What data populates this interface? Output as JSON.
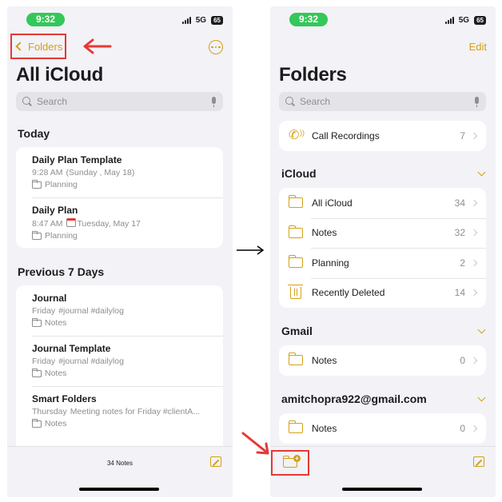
{
  "status": {
    "time": "9:32",
    "network": "5G",
    "battery": "65"
  },
  "left": {
    "back_label": "Folders",
    "title": "All iCloud",
    "search_placeholder": "Search",
    "sections": [
      {
        "title": "Today",
        "notes": [
          {
            "title": "Daily Plan Template",
            "time": "9:28 AM",
            "preview": "(Sunday , May 18)",
            "folder": "Planning",
            "calendar": false
          },
          {
            "title": "Daily Plan",
            "time": "8:47 AM",
            "preview": "Tuesday, May 17",
            "folder": "Planning",
            "calendar": true
          }
        ]
      },
      {
        "title": "Previous 7 Days",
        "notes": [
          {
            "title": "Journal",
            "time": "Friday",
            "preview": "#journal #dailylog",
            "folder": "Notes",
            "calendar": false
          },
          {
            "title": "Journal Template",
            "time": "Friday",
            "preview": "#journal #dailylog",
            "folder": "Notes",
            "calendar": false
          },
          {
            "title": "Smart Folders",
            "time": "Thursday",
            "preview": "Meeting notes for Friday #clientA...",
            "folder": "Notes",
            "calendar": false
          }
        ]
      }
    ],
    "notes_count": "34 Notes"
  },
  "right": {
    "edit_label": "Edit",
    "title": "Folders",
    "search_placeholder": "Search",
    "call_recordings": {
      "label": "Call Recordings",
      "count": "7"
    },
    "groups": [
      {
        "name": "iCloud",
        "folders": [
          {
            "label": "All iCloud",
            "count": "34",
            "icon": "folder-icon"
          },
          {
            "label": "Notes",
            "count": "32",
            "icon": "folder-icon"
          },
          {
            "label": "Planning",
            "count": "2",
            "icon": "folder-icon"
          },
          {
            "label": "Recently Deleted",
            "count": "14",
            "icon": "trash-icon"
          }
        ]
      },
      {
        "name": "Gmail",
        "folders": [
          {
            "label": "Notes",
            "count": "0",
            "icon": "folder-icon"
          }
        ]
      },
      {
        "name": "amitchopra922@gmail.com",
        "folders": [
          {
            "label": "Notes",
            "count": "0",
            "icon": "folder-icon"
          }
        ]
      }
    ]
  },
  "colors": {
    "accent": "#d4a017",
    "annotation": "#e53935",
    "status_pill": "#34c759",
    "background": "#f2f2f7"
  }
}
